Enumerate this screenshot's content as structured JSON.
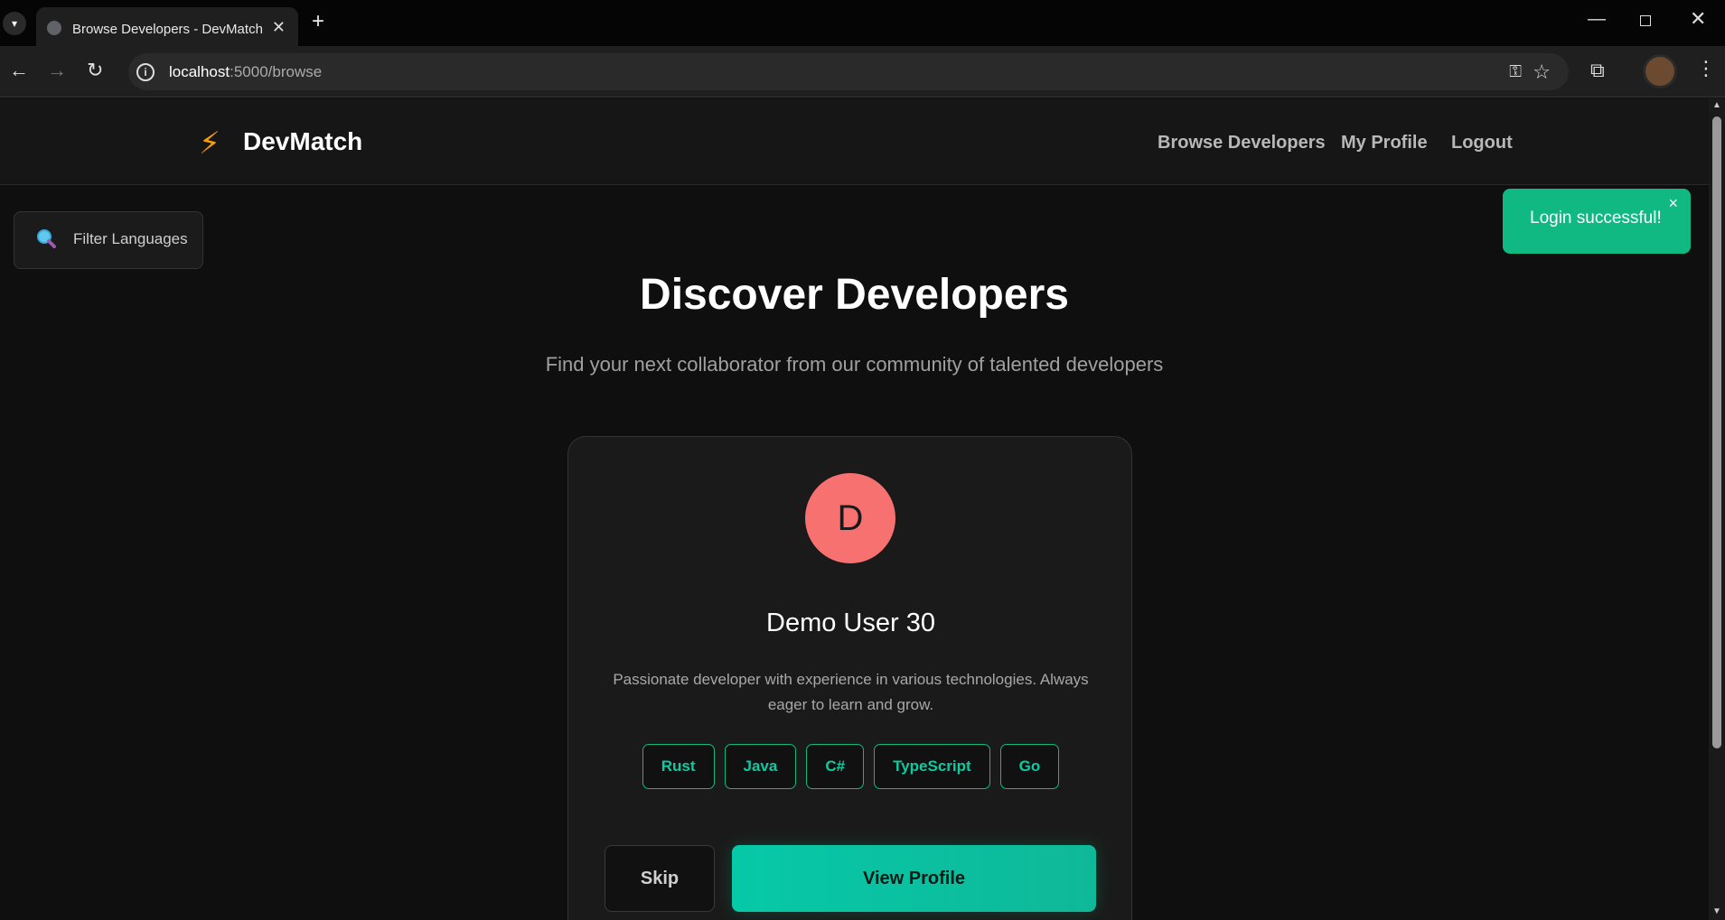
{
  "browser": {
    "tab_title": "Browse Developers - DevMatch",
    "url_host": "localhost",
    "url_path": ":5000/browse"
  },
  "app": {
    "brand": "DevMatch",
    "nav": {
      "browse": "Browse Developers",
      "profile": "My Profile",
      "logout": "Logout"
    }
  },
  "filter": {
    "label": "Filter Languages"
  },
  "toast": {
    "message": "Login successful!",
    "close": "×"
  },
  "page": {
    "title": "Discover Developers",
    "subtitle": "Find your next collaborator from our community of talented developers"
  },
  "card": {
    "initial": "D",
    "name": "Demo User 30",
    "bio": "Passionate developer with experience in various technologies. Always eager to learn and grow.",
    "languages": [
      "Rust",
      "Java",
      "C#",
      "TypeScript",
      "Go"
    ],
    "skip_label": "Skip",
    "view_label": "View Profile"
  },
  "colors": {
    "accent": "#10b981",
    "avatar": "#f87171",
    "bolt": "#f59e0b"
  }
}
